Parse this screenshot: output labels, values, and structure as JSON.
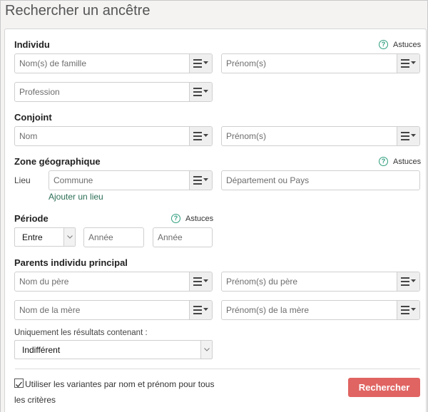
{
  "page": {
    "title": "Rechercher un ancêtre"
  },
  "hint_label": "Astuces",
  "individu": {
    "title": "Individu",
    "surname_placeholder": "Nom(s) de famille",
    "firstname_placeholder": "Prénom(s)",
    "profession_placeholder": "Profession"
  },
  "conjoint": {
    "title": "Conjoint",
    "surname_placeholder": "Nom",
    "firstname_placeholder": "Prénom(s)"
  },
  "zone": {
    "title": "Zone géographique",
    "place_label": "Lieu",
    "commune_placeholder": "Commune",
    "dept_placeholder": "Département ou Pays",
    "add_place_link": "Ajouter un lieu"
  },
  "periode": {
    "title": "Période",
    "mode_selected": "Entre",
    "year_from_placeholder": "Année",
    "year_to_placeholder": "Année"
  },
  "parents": {
    "title": "Parents individu principal",
    "father_surname_placeholder": "Nom du père",
    "father_firstname_placeholder": "Prénom(s) du père",
    "mother_surname_placeholder": "Nom de la mère",
    "mother_firstname_placeholder": "Prénom(s) de la mère"
  },
  "filter": {
    "label": "Uniquement les résultats contenant :",
    "selected": "Indifférent"
  },
  "variants": {
    "checked": true,
    "label_line1": "Utiliser les variantes par nom et prénom pour tous",
    "label_line2": "les critères"
  },
  "submit_label": "Rechercher",
  "colors": {
    "accent": "#e06462",
    "hint": "#2e9d7d",
    "link": "#2b6e55"
  }
}
